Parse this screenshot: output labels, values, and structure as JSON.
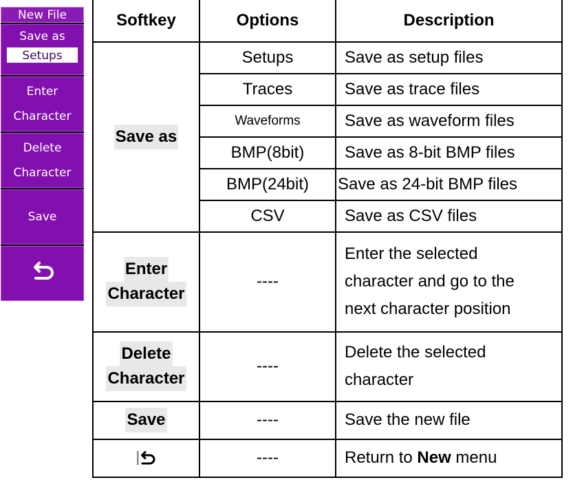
{
  "menu": {
    "title": "New File",
    "save_as": {
      "label": "Save as",
      "value": "Setups"
    },
    "enter": {
      "line1": "Enter",
      "line2": "Character"
    },
    "delete": {
      "line1": "Delete",
      "line2": "Character"
    },
    "save": "Save",
    "back_icon": "return-arrow-icon",
    "colors": {
      "bg": "#8210ae",
      "title_bg": "#8a1bb4",
      "text": "#ffffff"
    }
  },
  "table": {
    "headers": {
      "softkey": "Softkey",
      "options": "Options",
      "description": "Description"
    },
    "save_as": {
      "softkey": "Save as",
      "rows": [
        {
          "option": "Setups",
          "description": "Save as setup files"
        },
        {
          "option": "Traces",
          "description": "Save as trace files"
        },
        {
          "option": "Waveforms",
          "description": "Save as waveform files"
        },
        {
          "option": "BMP(8bit)",
          "description": "Save as 8-bit BMP files"
        },
        {
          "option": "BMP(24bit)",
          "description": "Save as 24-bit BMP files"
        },
        {
          "option": "CSV",
          "description": "Save as CSV files"
        }
      ]
    },
    "enter_character": {
      "softkey_line1": "Enter",
      "softkey_line2": "Character",
      "option": "----",
      "description_lines": [
        "Enter the selected",
        "character and go to the",
        "next character position"
      ]
    },
    "delete_character": {
      "softkey_line1": "Delete",
      "softkey_line2": "Character",
      "option": "----",
      "description_lines": [
        "Delete the selected",
        "character"
      ]
    },
    "save": {
      "softkey": "Save",
      "option": "----",
      "description": "Save the new file"
    },
    "return": {
      "softkey_icon": "return-arrow-icon",
      "option": "----",
      "description_pre": "Return to ",
      "description_bold": "New",
      "description_post": " menu"
    }
  }
}
